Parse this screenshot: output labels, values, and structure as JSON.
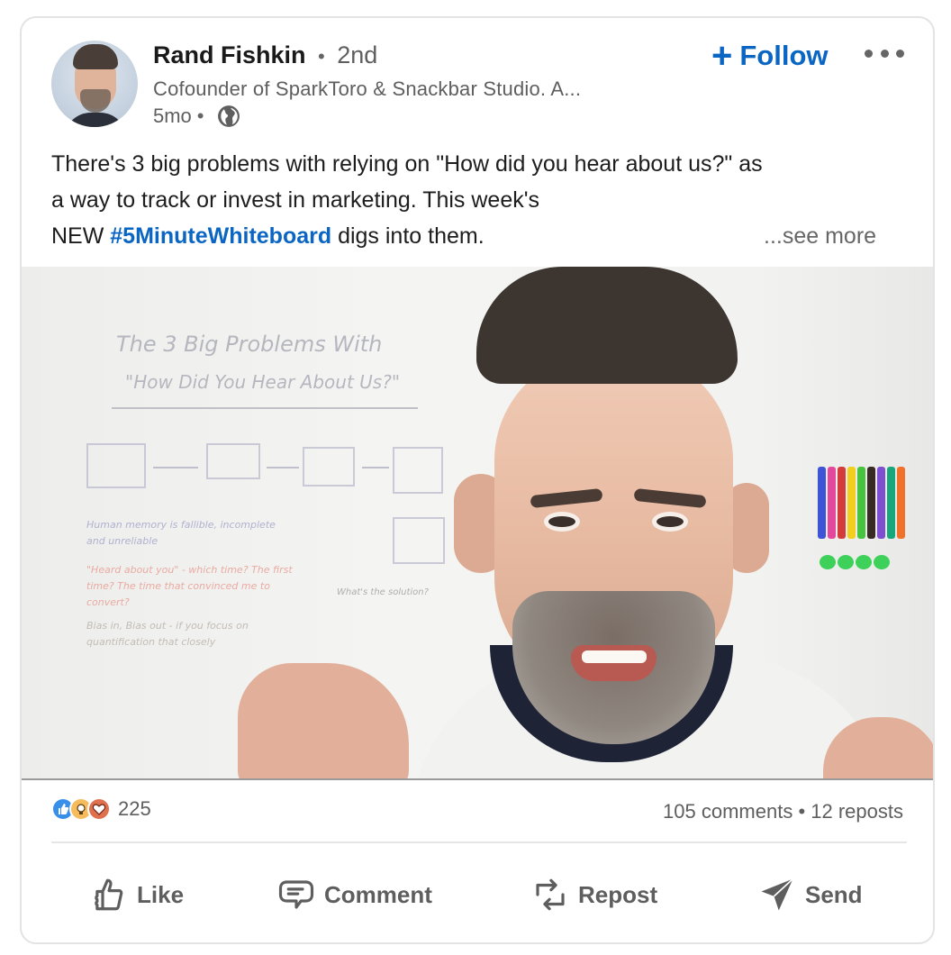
{
  "post": {
    "author": {
      "name": "Rand Fishkin",
      "separator": "•",
      "connection_degree": "2nd",
      "headline": "Cofounder of SparkToro & Snackbar Studio. A...",
      "time_ago": "5mo",
      "visibility_icon": "globe-icon"
    },
    "follow_label": "Follow",
    "follow_icon": "+",
    "more_icon": "ellipsis-icon",
    "text": {
      "line1": "There's 3 big problems with relying on \"How did you hear about us?\" as",
      "line2": "a way to track or invest in marketing. This week's",
      "line3_prefix": "NEW ",
      "hashtag": "#5MinuteWhiteboard",
      "line3_suffix": " digs into them.",
      "see_more": "...see more"
    },
    "video": {
      "whiteboard_title_1": "The 3 Big Problems With",
      "whiteboard_title_2": "\"How Did You Hear About Us?\"",
      "whiteboard_item_1": "Human memory is fallible, incomplete and unreliable",
      "whiteboard_item_2": "\"Heard about you\" - which time? The first time? The time that convinced me to convert?",
      "whiteboard_item_3": "Bias in, Bias out - if you focus on quantification that closely",
      "whiteboard_solution": "What's the solution?"
    },
    "social": {
      "reaction_icons": [
        "like-reaction-icon",
        "insightful-reaction-icon",
        "love-reaction-icon"
      ],
      "reaction_count": "225",
      "comments": "105 comments",
      "dot": " • ",
      "reposts": "12 reposts"
    },
    "actions": [
      {
        "label": "Like",
        "icon": "thumbs-up-icon"
      },
      {
        "label": "Comment",
        "icon": "comment-icon"
      },
      {
        "label": "Repost",
        "icon": "repost-icon"
      },
      {
        "label": "Send",
        "icon": "send-icon"
      }
    ],
    "colors": {
      "link_blue": "#0a66c2",
      "text_gray": "#5e5e5e",
      "like_blue": "#378fe9",
      "insight_yellow": "#f5bb5c",
      "love_red": "#df704d"
    }
  }
}
